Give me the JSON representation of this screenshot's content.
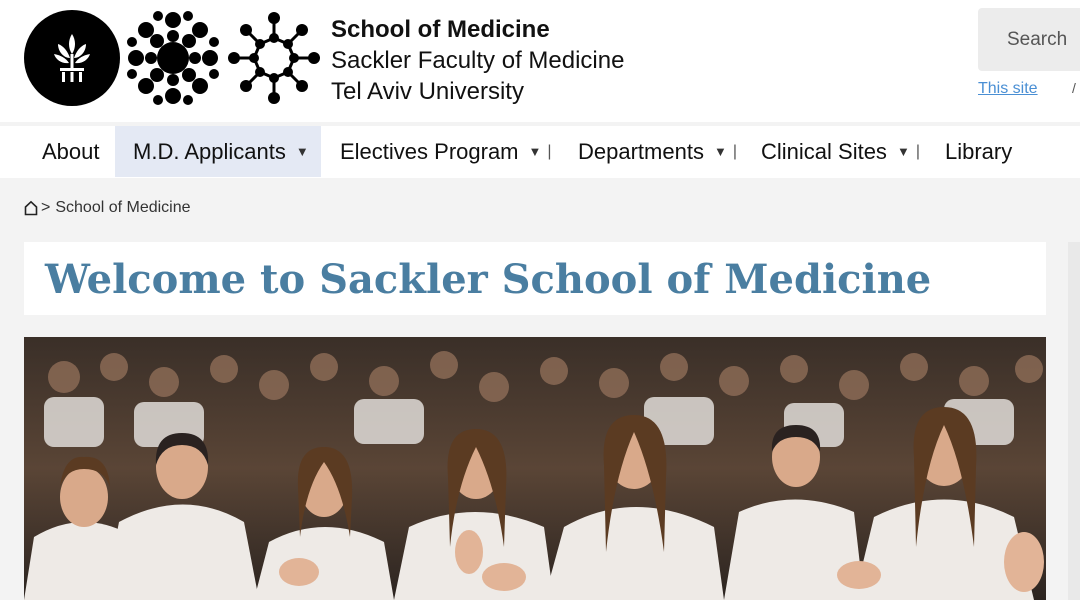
{
  "header": {
    "title_line1": "School of Medicine",
    "title_line2": "Sackler Faculty of Medicine",
    "title_line3": "Tel Aviv University",
    "logos": [
      "tau-emblem-icon",
      "cell-dots-logo-icon",
      "molecule-logo-icon"
    ]
  },
  "search": {
    "label": "Search",
    "scope_link": "This site",
    "scope_separator": "/"
  },
  "nav": {
    "items": [
      {
        "label": "About",
        "has_dropdown": false
      },
      {
        "label": "M.D. Applicants",
        "has_dropdown": true,
        "active": true
      },
      {
        "label": "Electives Program",
        "has_dropdown": true
      },
      {
        "label": "Departments",
        "has_dropdown": true
      },
      {
        "label": "Clinical Sites",
        "has_dropdown": true
      },
      {
        "label": "Library",
        "has_dropdown": false
      }
    ],
    "separator": "|"
  },
  "breadcrumb": {
    "home_icon": "home-icon",
    "separator": ">",
    "current": "School of Medicine"
  },
  "main": {
    "page_title": "Welcome to Sackler School of Medicine",
    "hero_image": "photo-of-medical-students-in-white-coats-applauding"
  },
  "colors": {
    "title": "#4a7ea1",
    "link": "#4a8fd4",
    "nav_active_bg": "#e4e9f4",
    "page_bg": "#f3f3f3"
  }
}
